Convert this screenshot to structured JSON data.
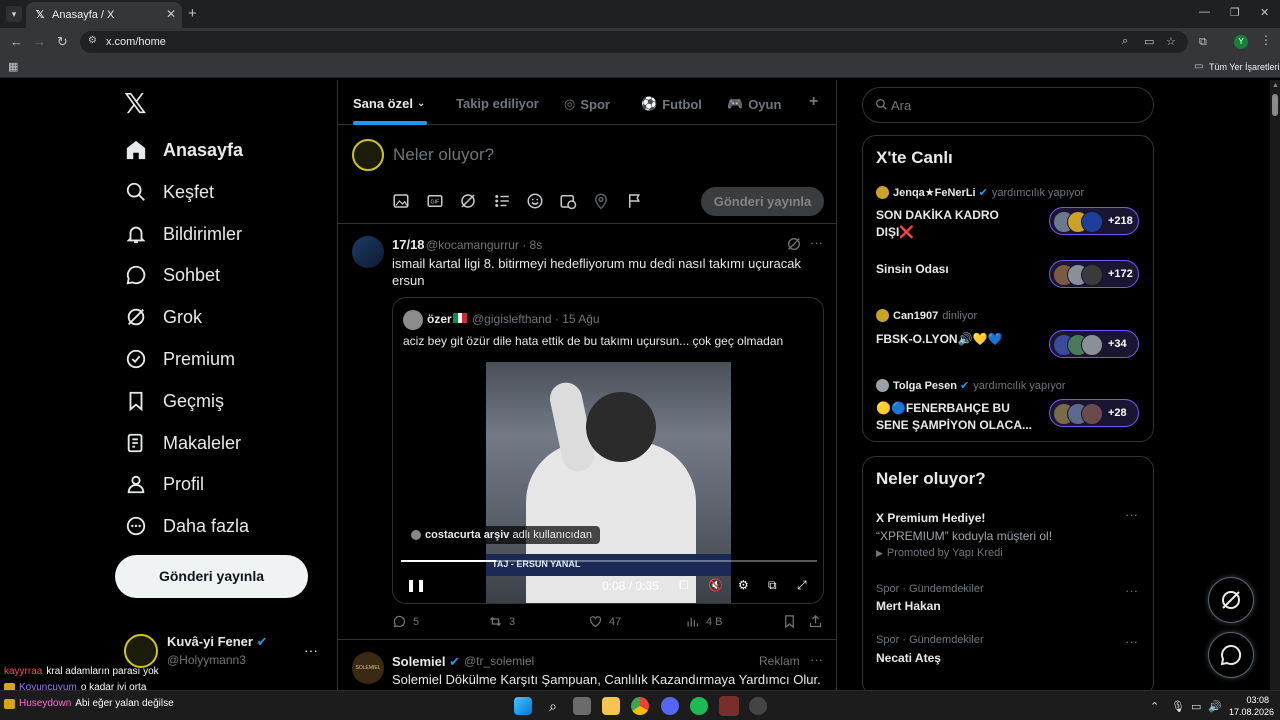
{
  "browser": {
    "tab_title": "Anasayfa / X",
    "url": "x.com/home",
    "bookmarks_label": "Tüm Yer İşaretleri",
    "profile_initial": "Y"
  },
  "sidebar": {
    "items": [
      {
        "label": "Anasayfa",
        "icon": "home-icon"
      },
      {
        "label": "Keşfet",
        "icon": "search-icon"
      },
      {
        "label": "Bildirimler",
        "icon": "bell-icon"
      },
      {
        "label": "Sohbet",
        "icon": "chat-icon"
      },
      {
        "label": "Grok",
        "icon": "grok-icon"
      },
      {
        "label": "Premium",
        "icon": "verified-icon"
      },
      {
        "label": "Geçmiş",
        "icon": "bookmark-icon"
      },
      {
        "label": "Makaleler",
        "icon": "articles-icon"
      },
      {
        "label": "Profil",
        "icon": "person-icon"
      },
      {
        "label": "Daha fazla",
        "icon": "more-circle-icon"
      }
    ],
    "post_button": "Gönderi yayınla",
    "account": {
      "name": "Kuvâ-yi Fener",
      "handle": "@Holyymann3"
    }
  },
  "feed": {
    "tabs": [
      "Sana özel",
      "Takip ediliyor",
      "Spor",
      "Futbol",
      "Oyun"
    ],
    "compose": {
      "placeholder": "Neler oluyor?",
      "button": "Gönderi yayınla"
    },
    "tweet": {
      "name": "17/18",
      "handle": "@kocamangurrur · 8s",
      "text": "ismail kartal ligi 8. bitirmeyi hedefliyorum mu dedi nasıl takımı uçuracak ersun",
      "quote": {
        "name": "özer",
        "handle": "@gigislefthand · 15 Ağu",
        "text": "aciz bey git özür dile hata ettik de bu takımı uçursun... çok geç olmadan",
        "video": {
          "credit_user": "costacurta arşiv",
          "credit_suffix": "adlı kullanıcıdan",
          "caption": "TAJ - ERSUN YANAL",
          "time": "0:08 / 0:35",
          "progress": 0.229
        }
      },
      "replies": "5",
      "reposts": "3",
      "likes": "47",
      "views": "4 B"
    },
    "ad": {
      "name": "Solemiel",
      "handle": "@tr_solemiel",
      "tag": "Reklam",
      "avatar_text": "SOLEMIEL",
      "text": "Solemiel Dökülme Karşıtı Şampuan, Canlılık Kazandırmaya Yardımcı Olur."
    }
  },
  "right": {
    "search_placeholder": "Ara",
    "live": {
      "title": "X'te Canlı",
      "items": [
        {
          "host": "Jenqa★FeNerLi",
          "role": "yardımcılık yapıyor",
          "title": "SON DAKİKA KADRO DIŞI❌",
          "count": "+218"
        },
        {
          "host": "",
          "role": "",
          "title": "Sinsin Odası",
          "count": "+172"
        },
        {
          "host": "Can1907",
          "role": "dinliyor",
          "title": "FBSK-O.LYON🔊💛💙",
          "count": "+34"
        },
        {
          "host": "Tolga Pesen",
          "role": "yardımcılık yapıyor",
          "title": "🟡🔵FENERBAHÇE BU SENE ŞAMPİYON OLACA...",
          "count": "+28"
        }
      ]
    },
    "trends": {
      "title": "Neler oluyor?",
      "promo": {
        "title": "X Premium Hediye!",
        "subtitle": "“XPREMIUM” koduyla müşteri ol!",
        "promoted": "Promoted by Yapı Kredi"
      },
      "items": [
        {
          "category": "Spor · Gündemdekiler",
          "title": "Mert Hakan"
        },
        {
          "category": "Spor · Gündemdekiler",
          "title": "Necati Ateş"
        }
      ]
    }
  },
  "chat": [
    {
      "user": "kayyrraa",
      "color": "#ff4a4a",
      "text": "kral adamların parası yok",
      "badge": false
    },
    {
      "user": "Koyuncuyum",
      "color": "#9b7bff",
      "text": "o kadar iyi orta",
      "badge": true
    },
    {
      "user": "Huseydown",
      "color": "#ff6ad5",
      "text": "Abi eğer yalan değilse",
      "badge": true
    }
  ],
  "taskbar": {
    "time": "03:08",
    "date": "17.08.2026"
  },
  "colors": {
    "accent": "#1d9bf0",
    "live_border": "#7856ff",
    "background": "#000000"
  }
}
